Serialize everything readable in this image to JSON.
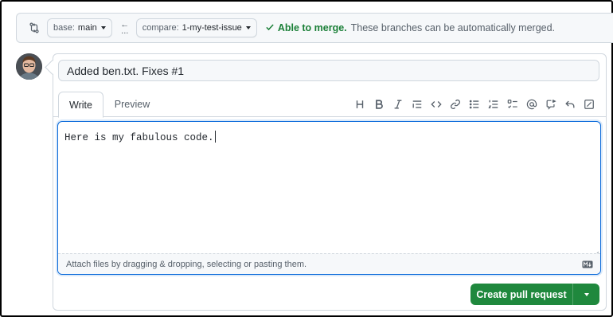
{
  "compare_bar": {
    "icon": "git-compare-icon",
    "base_label": "base:",
    "base_value": "main",
    "arrow": "←",
    "arrow_dots": "...",
    "compare_label": "compare:",
    "compare_value": "1-my-test-issue",
    "merge_ok": "Able to merge.",
    "merge_message": "These branches can be automatically merged."
  },
  "pr_form": {
    "title": "Added ben.txt. Fixes #1",
    "tabs": [
      "Write",
      "Preview"
    ],
    "toolbar_icons": [
      "heading-icon",
      "bold-icon",
      "italic-icon",
      "quote-icon",
      "code-icon",
      "link-icon",
      "unordered-list-icon",
      "ordered-list-icon",
      "task-list-icon",
      "mention-icon",
      "cross-reference-icon",
      "reply-icon",
      "fullscreen-icon"
    ],
    "body": "Here is my fabulous code.",
    "attach_hint": "Attach files by dragging & dropping, selecting or pasting them.",
    "submit_label": "Create pull request"
  },
  "colors": {
    "accent_blue": "#0969da",
    "success_green": "#1a7f37",
    "button_green": "#1f883d"
  }
}
